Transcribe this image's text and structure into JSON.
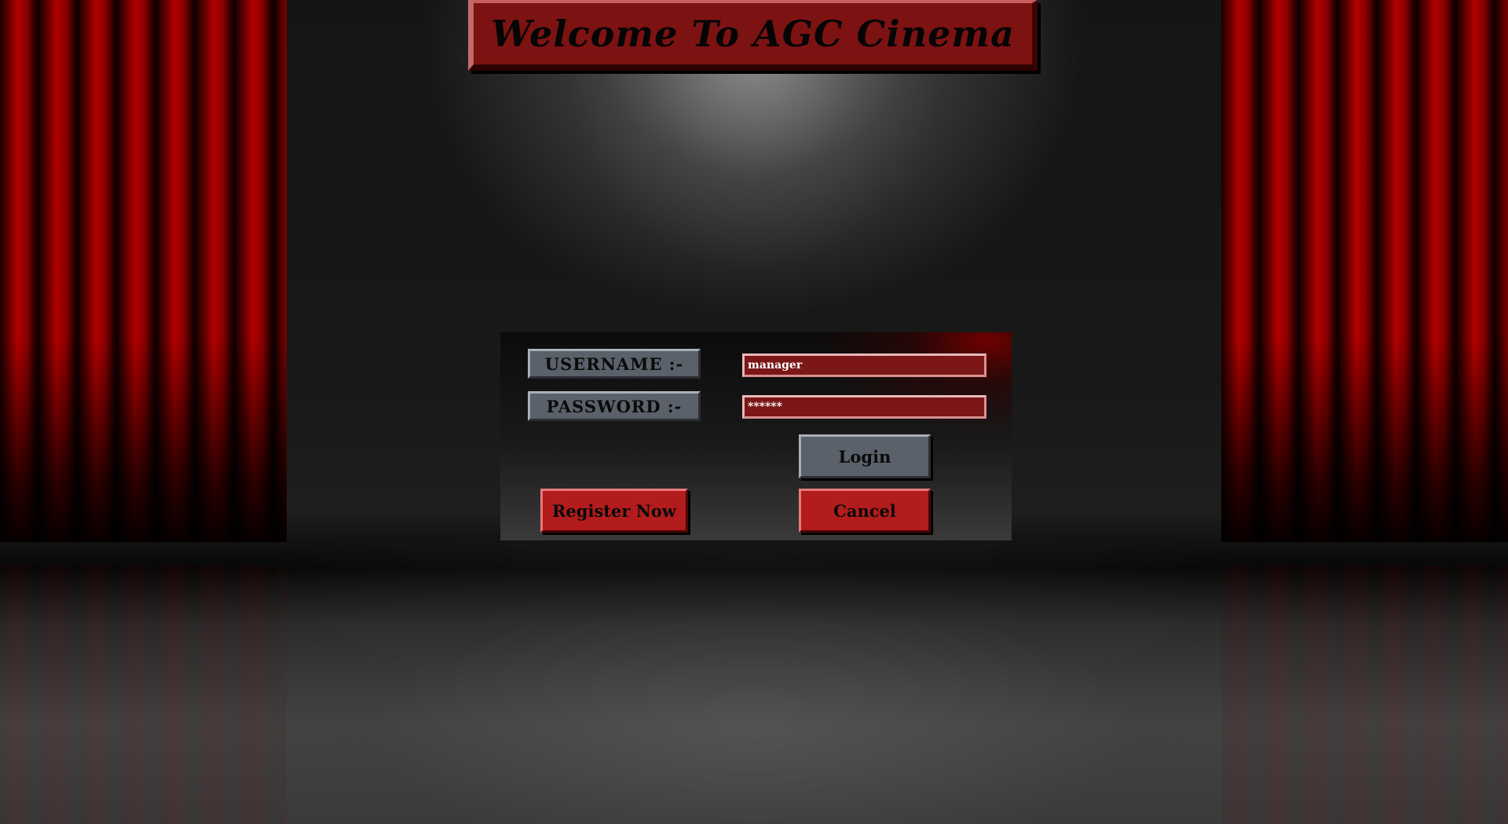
{
  "title": "Welcome To AGC Cinema",
  "login": {
    "username_label": "USERNAME :-",
    "password_label": "PASSWORD :-",
    "username_value": "manager",
    "password_value": "******",
    "login_button": "Login",
    "cancel_button": "Cancel",
    "register_button": "Register Now"
  },
  "colors": {
    "curtain_red": "#b30000",
    "banner_red": "#7d1212",
    "field_red": "#7b1717",
    "button_red": "#b31c1c",
    "button_grey": "#5b616a"
  }
}
